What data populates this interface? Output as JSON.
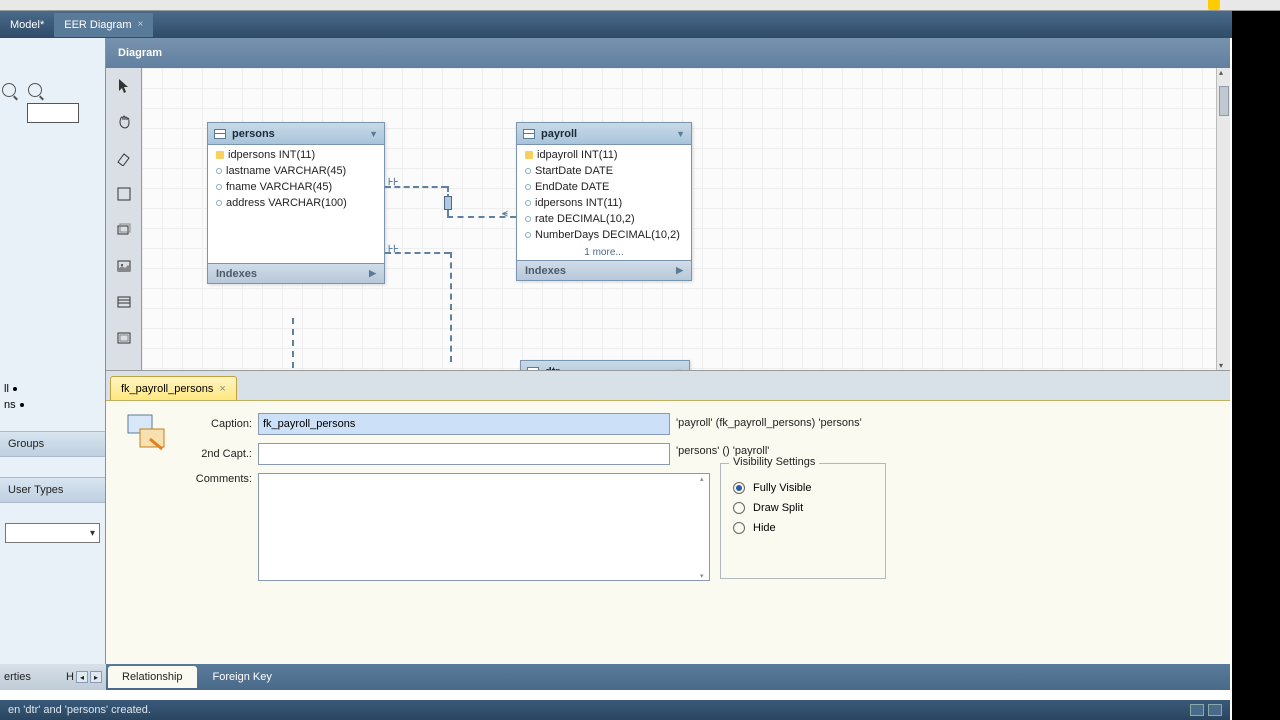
{
  "tabs": {
    "model": "Model*",
    "eer": "EER Diagram"
  },
  "diagram_label": "Diagram",
  "left_side": {
    "tree_items": [
      "ll",
      "ns"
    ],
    "section_groups": "Groups",
    "section_usertypes": "User Types"
  },
  "tools": [
    "pointer",
    "hand",
    "eraser",
    "note",
    "layer",
    "image",
    "table",
    "view"
  ],
  "entities": {
    "persons": {
      "name": "persons",
      "cols": [
        {
          "k": "pk",
          "t": "idpersons INT(11)"
        },
        {
          "k": "fld",
          "t": "lastname VARCHAR(45)"
        },
        {
          "k": "fld",
          "t": "fname VARCHAR(45)"
        },
        {
          "k": "fld",
          "t": "address VARCHAR(100)"
        }
      ],
      "indexes": "Indexes"
    },
    "payroll": {
      "name": "payroll",
      "cols": [
        {
          "k": "pk",
          "t": "idpayroll INT(11)"
        },
        {
          "k": "fld",
          "t": "StartDate DATE"
        },
        {
          "k": "fld",
          "t": "EndDate DATE"
        },
        {
          "k": "fld",
          "t": "idpersons INT(11)"
        },
        {
          "k": "fld",
          "t": "rate DECIMAL(10,2)"
        },
        {
          "k": "fld",
          "t": "NumberDays DECIMAL(10,2)"
        }
      ],
      "more": "1 more...",
      "indexes": "Indexes"
    },
    "dtr": {
      "name": "dtr"
    }
  },
  "prop_tab": {
    "name": "fk_payroll_persons"
  },
  "props": {
    "caption_label": "Caption:",
    "caption_value": "fk_payroll_persons",
    "capt2_label": "2nd Capt.:",
    "capt2_value": "",
    "comments_label": "Comments:",
    "side1": "'payroll' (fk_payroll_persons) 'persons'",
    "side2": "'persons' () 'payroll'",
    "vis_legend": "Visibility Settings",
    "vis_full": "Fully Visible",
    "vis_split": "Draw Split",
    "vis_hide": "Hide"
  },
  "bottom_tabs": {
    "rel": "Relationship",
    "fk": "Foreign Key"
  },
  "left_nav": {
    "label": "erties",
    "h": "H"
  },
  "status": "en 'dtr' and 'persons' created."
}
